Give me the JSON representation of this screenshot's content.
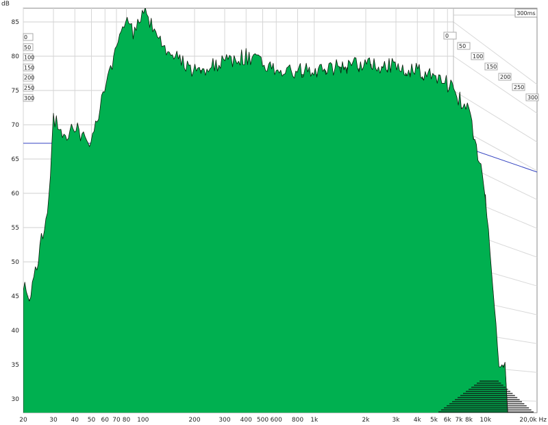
{
  "chart_data": {
    "type": "area",
    "subtype": "waterfall",
    "ylabel": "dB",
    "xlabel": "Hz",
    "x_scale": "log",
    "xlim": [
      20,
      20000
    ],
    "ylim": [
      28,
      87
    ],
    "y_ticks": [
      30,
      35,
      40,
      45,
      50,
      55,
      60,
      65,
      70,
      75,
      80,
      85
    ],
    "x_ticks": [
      {
        "value": 20,
        "label": "20"
      },
      {
        "value": 30,
        "label": "30"
      },
      {
        "value": 40,
        "label": "40"
      },
      {
        "value": 50,
        "label": "50"
      },
      {
        "value": 60,
        "label": "60"
      },
      {
        "value": 70,
        "label": "70"
      },
      {
        "value": 80,
        "label": "80"
      },
      {
        "value": 100,
        "label": "100"
      },
      {
        "value": 200,
        "label": "200"
      },
      {
        "value": 300,
        "label": "300"
      },
      {
        "value": 400,
        "label": "400"
      },
      {
        "value": 500,
        "label": "500"
      },
      {
        "value": 600,
        "label": "600"
      },
      {
        "value": 800,
        "label": "800"
      },
      {
        "value": 1000,
        "label": "1k"
      },
      {
        "value": 2000,
        "label": "2k"
      },
      {
        "value": 3000,
        "label": "3k"
      },
      {
        "value": 4000,
        "label": "4k"
      },
      {
        "value": 5000,
        "label": "5k"
      },
      {
        "value": 6000,
        "label": "6k"
      },
      {
        "value": 7000,
        "label": "7k"
      },
      {
        "value": 8000,
        "label": "8k"
      },
      {
        "value": 10000,
        "label": "10k"
      },
      {
        "value": 20000,
        "label": "20,0k Hz"
      }
    ],
    "time_axis_unit": "ms",
    "time_end_label": "300ms",
    "time_labels_left": [
      "0",
      "50",
      "100",
      "150",
      "200",
      "250",
      "300"
    ],
    "time_labels_right": [
      "0",
      "50",
      "100",
      "150",
      "200",
      "250",
      "300"
    ],
    "grid": true,
    "fill_color": "#00b050",
    "line_color": "#0a1a0a",
    "reference_line_color": "#3040c0",
    "reference_level_db": 67.3,
    "front_slice_peaks": [
      {
        "x": 20,
        "y": 47
      },
      {
        "x": 22,
        "y": 45
      },
      {
        "x": 25,
        "y": 52
      },
      {
        "x": 28,
        "y": 58
      },
      {
        "x": 30,
        "y": 71
      },
      {
        "x": 33,
        "y": 69
      },
      {
        "x": 36,
        "y": 68
      },
      {
        "x": 40,
        "y": 70
      },
      {
        "x": 45,
        "y": 68
      },
      {
        "x": 50,
        "y": 68
      },
      {
        "x": 60,
        "y": 75
      },
      {
        "x": 70,
        "y": 81
      },
      {
        "x": 80,
        "y": 85
      },
      {
        "x": 90,
        "y": 83
      },
      {
        "x": 100,
        "y": 87
      },
      {
        "x": 120,
        "y": 83
      },
      {
        "x": 150,
        "y": 80
      },
      {
        "x": 200,
        "y": 78
      },
      {
        "x": 300,
        "y": 79
      },
      {
        "x": 400,
        "y": 80
      },
      {
        "x": 600,
        "y": 78
      },
      {
        "x": 1000,
        "y": 78
      },
      {
        "x": 2000,
        "y": 79
      },
      {
        "x": 4000,
        "y": 78
      },
      {
        "x": 6000,
        "y": 76
      },
      {
        "x": 8000,
        "y": 72
      },
      {
        "x": 10000,
        "y": 60
      },
      {
        "x": 12000,
        "y": 35
      }
    ]
  }
}
